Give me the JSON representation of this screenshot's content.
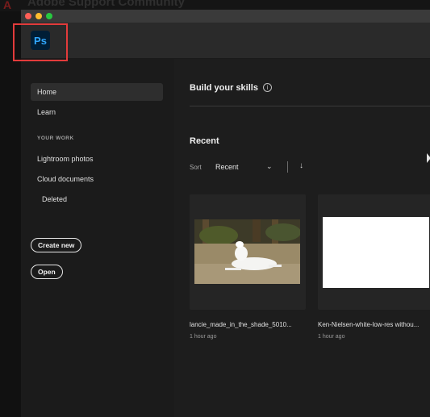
{
  "background": {
    "partial_text": "Adobe Support Community",
    "icon": "adobe-logo-icon"
  },
  "titlebar": {
    "controls": [
      "close-icon",
      "minimize-icon",
      "zoom-icon"
    ],
    "colors": {
      "close": "#fe5f57",
      "minimize": "#febc2e",
      "zoom": "#28c840"
    }
  },
  "app": {
    "logo_text": "Ps",
    "logo_color": "#31a8ff",
    "highlight_color": "#e23b3b"
  },
  "sidebar": {
    "items": [
      {
        "label": "Home",
        "active": true
      },
      {
        "label": "Learn"
      }
    ],
    "section_label": "YOUR WORK",
    "work_items": [
      {
        "label": "Lightroom photos"
      },
      {
        "label": "Cloud documents"
      },
      {
        "label": "Deleted"
      }
    ],
    "buttons": {
      "create_new": "Create new",
      "open": "Open"
    }
  },
  "main": {
    "skills_heading": "Build your skills",
    "info_glyph": "i",
    "recent_heading": "Recent",
    "sort": {
      "label": "Sort",
      "value": "Recent",
      "chevron": "⌄",
      "order_glyph": "↓"
    },
    "files": [
      {
        "name": "lancie_made_in_the_shade_5010...",
        "time": "1 hour ago",
        "thumbnail": "white dog resting on grass"
      },
      {
        "name": "Ken-Nielsen-white-low-res withou...",
        "time": "1 hour ago",
        "thumbnail": "white image"
      }
    ]
  }
}
